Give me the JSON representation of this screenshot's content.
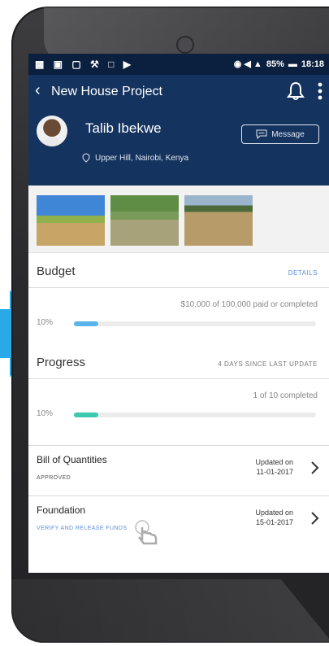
{
  "status_bar": {
    "left_icons": [
      "notification-icons"
    ],
    "battery_percent": "85%",
    "time": "18:18"
  },
  "app_bar": {
    "title": "New House Project"
  },
  "profile": {
    "name": "Talib Ibekwe",
    "location": "Upper Hill, Nairobi, Kenya",
    "message_label": "Message"
  },
  "budget": {
    "title": "Budget",
    "details_link": "DETAILS",
    "summary": "$10,000 of 100,000 paid or completed",
    "percent_label": "10%",
    "progress": 0.1,
    "bar_color": "#5ab4ea"
  },
  "progress": {
    "title": "Progress",
    "last_update": "4 DAYS SINCE LAST UPDATE",
    "summary": "1 of 10 completed",
    "percent_label": "10%",
    "progress": 0.1,
    "bar_color": "#3cc9b0"
  },
  "items": [
    {
      "title": "Bill of Quantities",
      "status": "APPROVED",
      "status_color": "#555555",
      "updated_label": "Updated on",
      "updated_date": "11-01-2017"
    },
    {
      "title": "Foundation",
      "status": "VERIFY AND RELEASE FUNDS",
      "status_color": "#5b8fd8",
      "updated_label": "Updated on",
      "updated_date": "15-01-2017"
    }
  ],
  "colors": {
    "header": "#15335f",
    "status_bar": "#0b1f3f",
    "pointer": "#29a9e8"
  }
}
